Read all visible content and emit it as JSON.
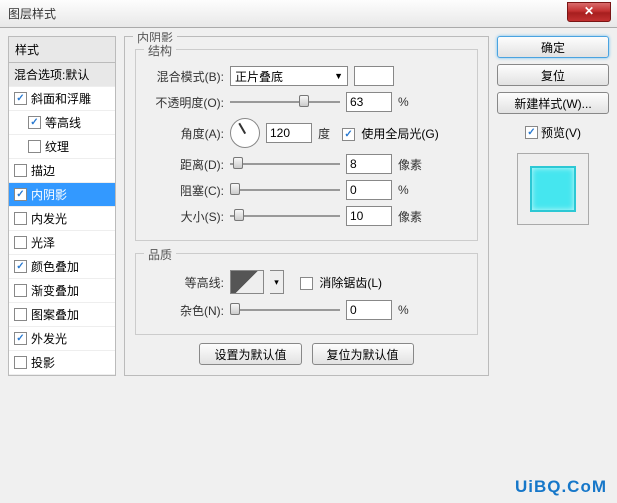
{
  "window": {
    "title": "图层样式"
  },
  "sidebar": {
    "header": "样式",
    "blend_row": "混合选项:默认",
    "items": [
      {
        "label": "斜面和浮雕",
        "checked": true,
        "indent": false
      },
      {
        "label": "等高线",
        "checked": true,
        "indent": true
      },
      {
        "label": "纹理",
        "checked": false,
        "indent": true
      },
      {
        "label": "描边",
        "checked": false,
        "indent": false
      },
      {
        "label": "内阴影",
        "checked": true,
        "selected": true,
        "indent": false
      },
      {
        "label": "内发光",
        "checked": false,
        "indent": false
      },
      {
        "label": "光泽",
        "checked": false,
        "indent": false
      },
      {
        "label": "颜色叠加",
        "checked": true,
        "indent": false
      },
      {
        "label": "渐变叠加",
        "checked": false,
        "indent": false
      },
      {
        "label": "图案叠加",
        "checked": false,
        "indent": false
      },
      {
        "label": "外发光",
        "checked": true,
        "indent": false
      },
      {
        "label": "投影",
        "checked": false,
        "indent": false
      }
    ]
  },
  "panel": {
    "title": "内阴影",
    "structure": {
      "legend": "结构",
      "blend_mode_label": "混合模式(B):",
      "blend_mode_value": "正片叠底",
      "opacity_label": "不透明度(O):",
      "opacity_value": "63",
      "opacity_unit": "%",
      "angle_label": "角度(A):",
      "angle_value": "120",
      "angle_unit": "度",
      "global_light_label": "使用全局光(G)",
      "distance_label": "距离(D):",
      "distance_value": "8",
      "distance_unit": "像素",
      "choke_label": "阻塞(C):",
      "choke_value": "0",
      "choke_unit": "%",
      "size_label": "大小(S):",
      "size_value": "10",
      "size_unit": "像素"
    },
    "quality": {
      "legend": "品质",
      "contour_label": "等高线:",
      "anti_alias_label": "消除锯齿(L)",
      "noise_label": "杂色(N):",
      "noise_value": "0",
      "noise_unit": "%"
    },
    "buttons": {
      "make_default": "设置为默认值",
      "reset_default": "复位为默认值"
    }
  },
  "right": {
    "ok": "确定",
    "cancel": "复位",
    "new_style": "新建样式(W)...",
    "preview_label": "预览(V)"
  },
  "watermark": "UiBQ.CoM"
}
